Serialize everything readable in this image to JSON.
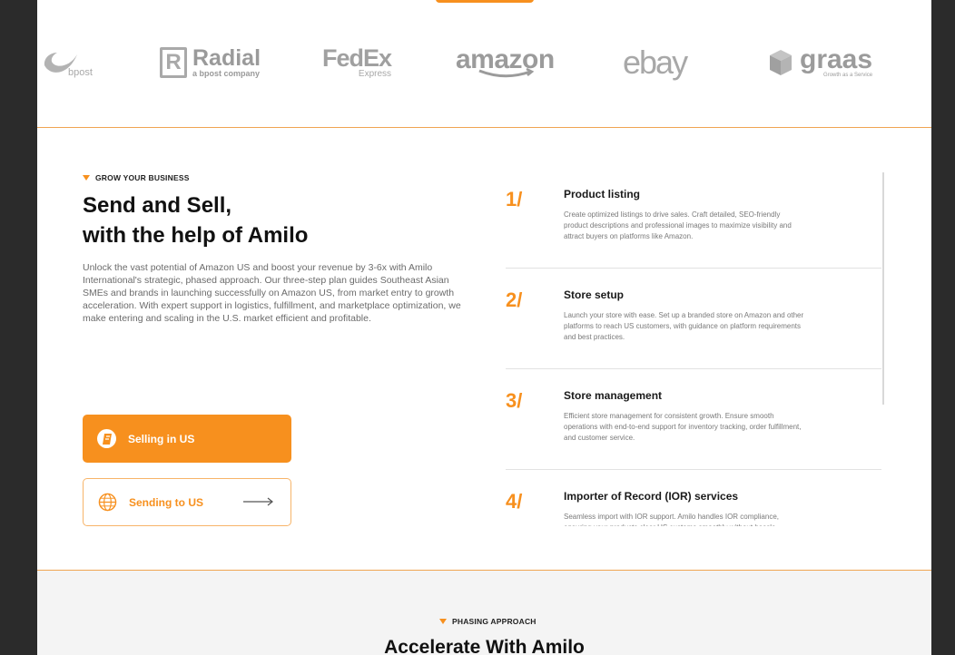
{
  "logos": {
    "bpost": "bpost",
    "radial": {
      "name": "Radial",
      "tagline": "a bpost company"
    },
    "fedex": {
      "name": "FedEx",
      "sub": "Express"
    },
    "amazon": "amazon",
    "ebay": "ebay",
    "graas": {
      "name": "graas",
      "tagline": "Growth as a Service"
    }
  },
  "grow": {
    "eyebrow": "GROW YOUR BUSINESS",
    "heading_line1": "Send and Sell,",
    "heading_line2": "with the help of Amilo",
    "intro": "Unlock the vast potential of Amazon US and boost your revenue by 3-6x with Amilo International's strategic, phased approach. Our three-step plan guides Southeast Asian SMEs and brands in launching successfully on Amazon US, from market entry to growth acceleration. With expert support in logistics, fulfillment, and marketplace optimization, we make entering and scaling in the U.S. market efficient and profitable.",
    "btn_selling": "Selling in US",
    "btn_sending": "Sending to US"
  },
  "steps": [
    {
      "num": "1/",
      "title": "Product listing",
      "desc": "Create optimized listings to drive sales. Craft detailed, SEO-friendly product descriptions and professional images to maximize visibility and attract buyers on platforms like Amazon."
    },
    {
      "num": "2/",
      "title": "Store setup",
      "desc": "Launch your store with ease. Set up a branded store on Amazon and other platforms to reach US customers, with guidance on platform requirements and best practices."
    },
    {
      "num": "3/",
      "title": "Store management",
      "desc": "Efficient store management for consistent growth. Ensure smooth operations with end-to-end support for inventory tracking, order fulfillment, and customer service."
    },
    {
      "num": "4/",
      "title": "Importer of Record (IOR) services",
      "desc": "Seamless import with IOR support. Amilo handles IOR compliance, ensuring your products clear US customs smoothly without hassle."
    }
  ],
  "phasing": {
    "eyebrow": "PHASING APPROACH",
    "title": "Accelerate With Amilo"
  },
  "colors": {
    "accent": "#f7901e",
    "logo_gray": "#a9a9a9"
  }
}
